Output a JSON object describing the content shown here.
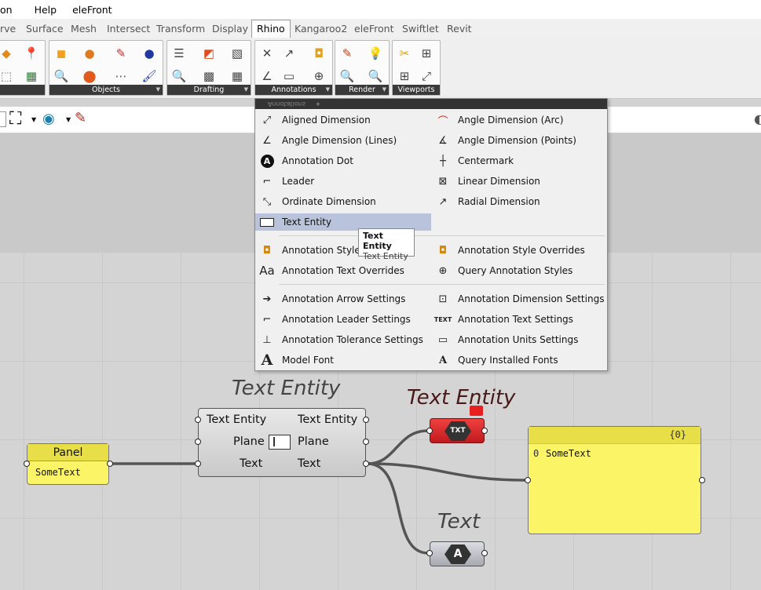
{
  "menubar": {
    "items": [
      "on",
      "Help",
      "eleFront"
    ]
  },
  "tabs": [
    "rve",
    "Surface",
    "Mesh",
    "Intersect",
    "Transform",
    "Display",
    "Rhino",
    "Kangaroo2",
    "eleFront",
    "Swiftlet",
    "Revit"
  ],
  "active_tab": "Rhino",
  "ribbon": {
    "groups": [
      {
        "label": ""
      },
      {
        "label": "Objects"
      },
      {
        "label": "Drafting"
      },
      {
        "label": "Annotations"
      },
      {
        "label": "Render"
      },
      {
        "label": "Viewports"
      }
    ]
  },
  "dropdown": {
    "header": "Annotations",
    "left_items": [
      {
        "label": "Aligned Dimension",
        "icon": "aligned-dimension-icon"
      },
      {
        "label": "Angle Dimension (Lines)",
        "icon": "angle-dimension-lines-icon"
      },
      {
        "label": "Annotation Dot",
        "icon": "annotation-dot-icon"
      },
      {
        "label": "Leader",
        "icon": "leader-icon"
      },
      {
        "label": "Ordinate Dimension",
        "icon": "ordinate-dimension-icon"
      },
      {
        "label": "Text Entity",
        "icon": "text-entity-icon"
      },
      {
        "label": "Annotation Style",
        "icon": "annotation-style-icon"
      },
      {
        "label": "Annotation Text Overrides",
        "icon": "annotation-text-overrides-icon"
      },
      {
        "label": "Annotation Arrow Settings",
        "icon": "arrow-settings-icon"
      },
      {
        "label": "Annotation Leader Settings",
        "icon": "leader-settings-icon"
      },
      {
        "label": "Annotation Tolerance Settings",
        "icon": "tolerance-settings-icon"
      },
      {
        "label": "Model Font",
        "icon": "model-font-icon"
      }
    ],
    "right_items": [
      {
        "label": "Angle Dimension (Arc)",
        "icon": "angle-dimension-arc-icon"
      },
      {
        "label": "Angle Dimension (Points)",
        "icon": "angle-dimension-points-icon"
      },
      {
        "label": "Centermark",
        "icon": "centermark-icon"
      },
      {
        "label": "Linear Dimension",
        "icon": "linear-dimension-icon"
      },
      {
        "label": "Radial Dimension",
        "icon": "radial-dimension-icon"
      },
      {
        "label": "Annotation Style Overrides",
        "icon": "style-overrides-icon"
      },
      {
        "label": "Query Annotation Styles",
        "icon": "query-styles-icon"
      },
      {
        "label": "Annotation Dimension Settings",
        "icon": "dimension-settings-icon"
      },
      {
        "label": "Annotation Text Settings",
        "icon": "text-settings-icon"
      },
      {
        "label": "Annotation Units Settings",
        "icon": "units-settings-icon"
      },
      {
        "label": "Query Installed Fonts",
        "icon": "query-fonts-icon"
      }
    ],
    "highlighted": "Text Entity",
    "tooltip": {
      "title": "Text Entity",
      "subtitle": "Text Entity"
    },
    "icon_text": {
      "annotation_dot": "A",
      "text_overrides": "Aa",
      "model_font": "A",
      "text_settings": "TEXT"
    }
  },
  "canvas": {
    "panel": {
      "title": "Panel",
      "value": "SomeText"
    },
    "text_entity_component": {
      "title": "Text Entity",
      "inputs": [
        "Text Entity",
        "Plane",
        "Text"
      ],
      "outputs": [
        "Text Entity",
        "Plane",
        "Text"
      ]
    },
    "text_entity_red": {
      "title": "Text Entity",
      "icon_label": "TXT"
    },
    "text_component": {
      "title": "Text",
      "icon_label": "A"
    },
    "output_panel": {
      "header": "{0}",
      "index": "0",
      "value": "SomeText"
    }
  },
  "colors": {
    "highlight": "#b9c4dc",
    "panel_yellow": "#faf466",
    "red_component": "#d8262c",
    "wire": "#555555"
  }
}
